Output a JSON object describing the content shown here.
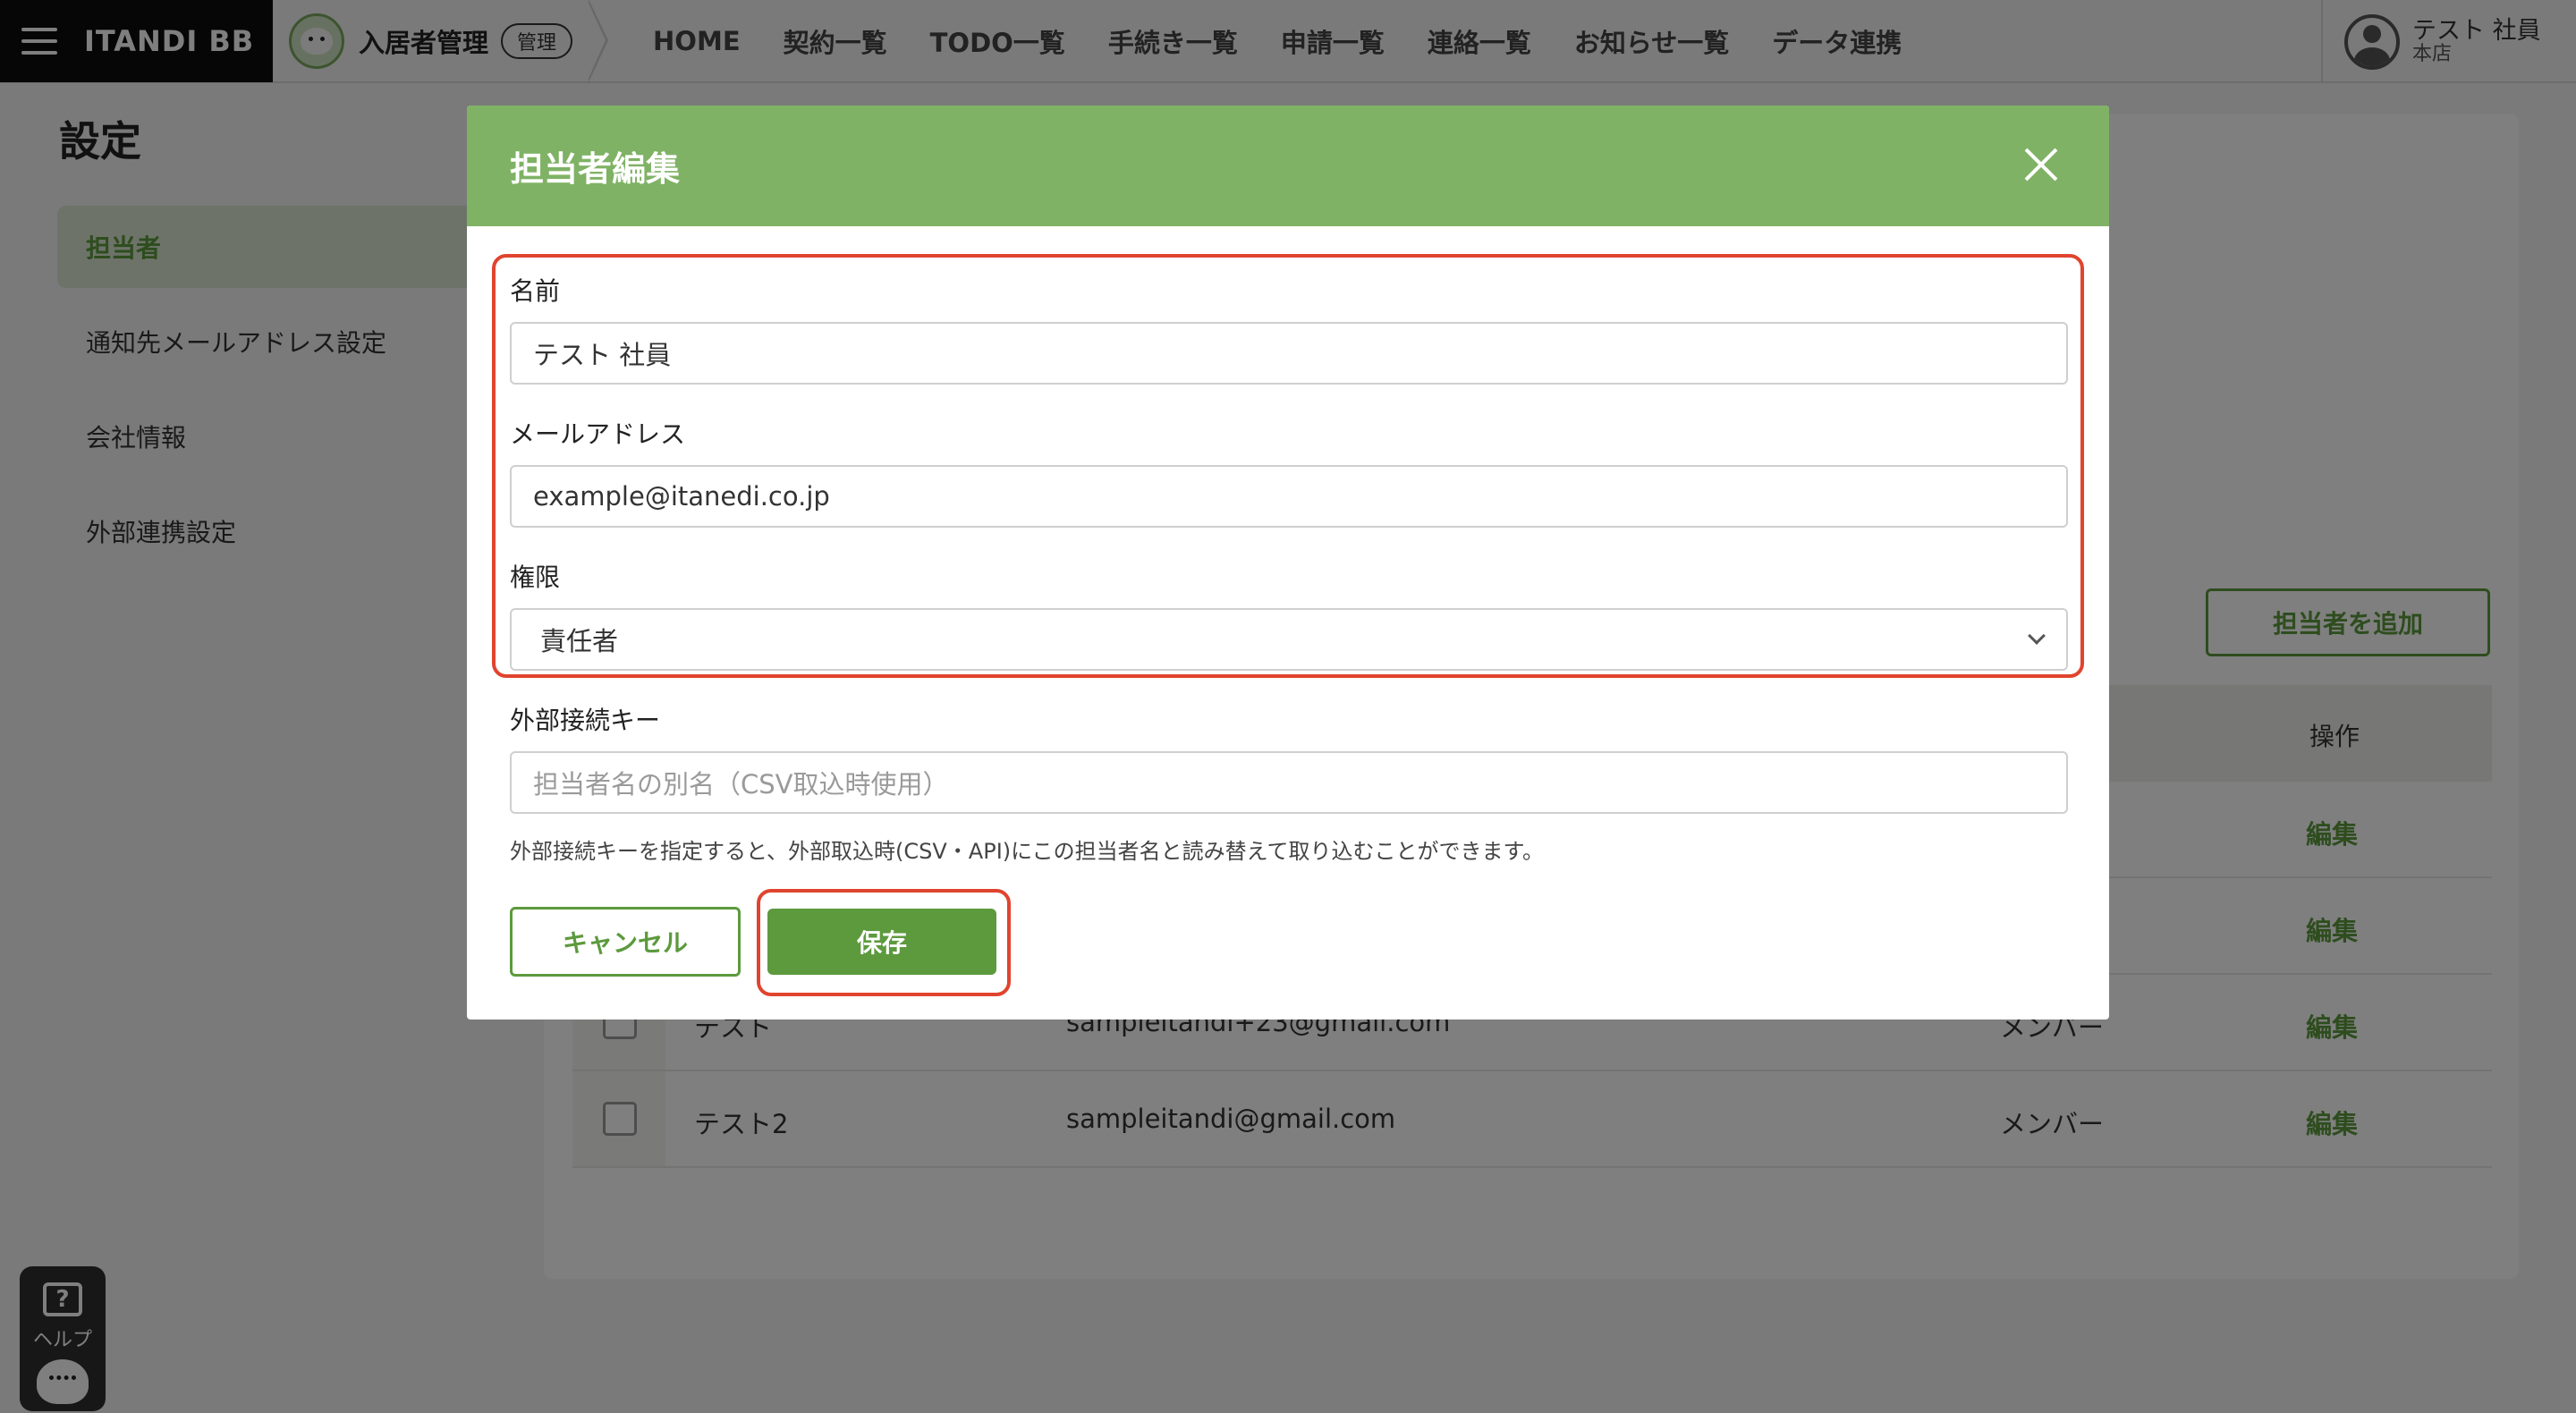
{
  "topnav": {
    "brand": "ITANDI BB",
    "product_name": "入居者管理",
    "product_badge": "管理",
    "menu": [
      "HOME",
      "契約一覧",
      "TODO一覧",
      "手続き一覧",
      "申請一覧",
      "連絡一覧",
      "お知らせ一覧",
      "データ連携"
    ],
    "user_name": "テスト 社員",
    "user_branch": "本店"
  },
  "page": {
    "title": "設定",
    "sidebar": [
      "担当者",
      "通知先メールアドレス設定",
      "会社情報",
      "外部連携設定"
    ],
    "add_button": "担当者を追加",
    "table": {
      "op_header": "操作",
      "rows": [
        {
          "name": "",
          "email": "",
          "role": "",
          "edit": "編集"
        },
        {
          "name": "",
          "email": "",
          "role": "",
          "edit": "編集"
        },
        {
          "name": "テスト",
          "email": "sampleitandi+23@gmail.com",
          "role": "メンバー",
          "edit": "編集"
        },
        {
          "name": "テスト2",
          "email": "sampleitandi@gmail.com",
          "role": "メンバー",
          "edit": "編集"
        }
      ]
    },
    "help_label": "ヘルプ"
  },
  "modal": {
    "title": "担当者編集",
    "name_label": "名前",
    "name_value": "テスト 社員",
    "email_label": "メールアドレス",
    "email_value": "example@itanedi.co.jp",
    "role_label": "権限",
    "role_value": "責任者",
    "key_label": "外部接続キー",
    "key_placeholder": "担当者名の別名（CSV取込時使用）",
    "hint": "外部接続キーを指定すると、外部取込時(CSV・API)にこの担当者名と読み替えて取り込むことができます。",
    "cancel_label": "キャンセル",
    "save_label": "保存"
  },
  "colors": {
    "brand_green": "#5c9a3d",
    "header_green": "#7fb265",
    "highlight_red": "#e0442e"
  }
}
